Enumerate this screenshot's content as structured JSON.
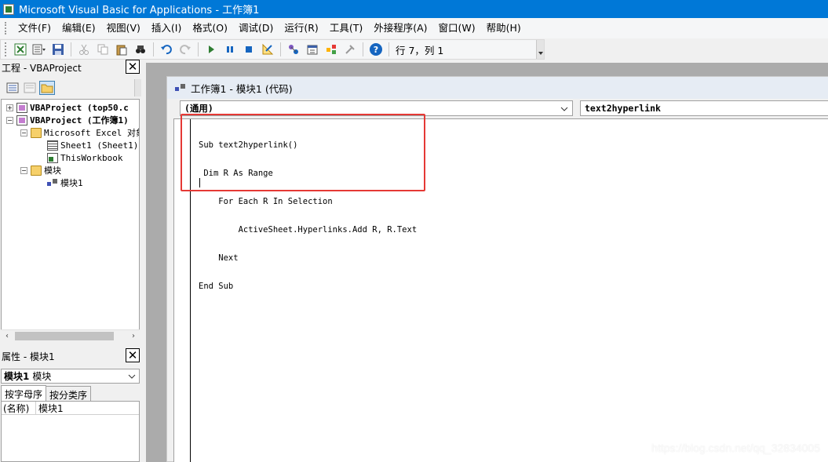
{
  "app": {
    "title": "Microsoft Visual Basic for Applications - 工作簿1"
  },
  "menu": [
    {
      "label": "文件(F)"
    },
    {
      "label": "编辑(E)"
    },
    {
      "label": "视图(V)"
    },
    {
      "label": "插入(I)"
    },
    {
      "label": "格式(O)"
    },
    {
      "label": "调试(D)"
    },
    {
      "label": "运行(R)"
    },
    {
      "label": "工具(T)"
    },
    {
      "label": "外接程序(A)"
    },
    {
      "label": "窗口(W)"
    },
    {
      "label": "帮助(H)"
    }
  ],
  "toolbar": {
    "status": "行 7，列 1"
  },
  "project_pane": {
    "title": "工程 - VBAProject",
    "tree": [
      {
        "text": "VBAProject (top50.c"
      },
      {
        "text": "VBAProject (工作簿1)"
      },
      {
        "text": "Microsoft Excel 对象"
      },
      {
        "text": "Sheet1 (Sheet1)"
      },
      {
        "text": "ThisWorkbook"
      },
      {
        "text": "模块"
      },
      {
        "text": "模块1"
      }
    ]
  },
  "properties_pane": {
    "title": "属性 - 模块1",
    "object_name": "模块1",
    "object_type": "模块",
    "tabs": [
      "按字母序",
      "按分类序"
    ],
    "rows": [
      {
        "key": "(名称)",
        "value": "模块1"
      }
    ]
  },
  "code_window": {
    "title": "工作簿1 - 模块1 (代码)",
    "object_combo": "(通用)",
    "procedure_combo": "text2hyperlink",
    "lines": [
      "Sub text2hyperlink()",
      " Dim R As Range",
      "    For Each R In Selection",
      "        ActiveSheet.Hyperlinks.Add R, R.Text",
      "    Next",
      "End Sub"
    ]
  },
  "watermark": "https://blog.csdn.net/qq_32834005",
  "colors": {
    "titlebar": "#0078d7",
    "highlight": "#e53935",
    "keyword": "#00008b"
  }
}
